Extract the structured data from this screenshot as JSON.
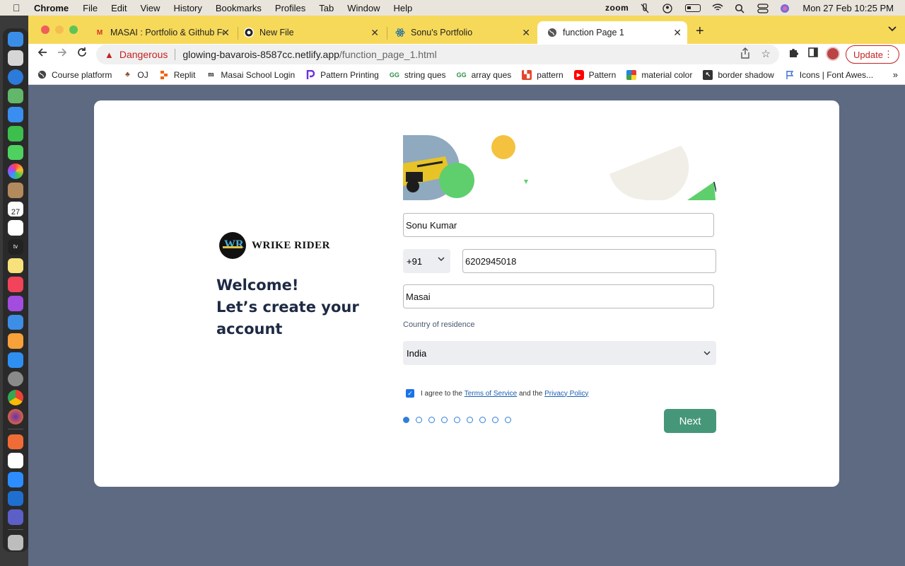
{
  "menubar": {
    "app_name": "Chrome",
    "menus": [
      "File",
      "Edit",
      "View",
      "History",
      "Bookmarks",
      "Profiles",
      "Tab",
      "Window",
      "Help"
    ],
    "zoom_label": "zoom",
    "datetime": "Mon 27 Feb  10:25 PM"
  },
  "dock": {
    "calendar_day": "27",
    "apps": [
      "finder",
      "launchpad",
      "safari",
      "maps",
      "mail",
      "facetime",
      "messages",
      "photos",
      "contacts",
      "calendar",
      "reminders",
      "apple-tv",
      "notes",
      "music",
      "podcasts",
      "keynote",
      "pages",
      "app-store",
      "system-preferences",
      "chrome",
      "firefox",
      "postman",
      "slack",
      "zoom",
      "vscode",
      "teams",
      "trash"
    ]
  },
  "tabs": [
    {
      "title": "MASAI : Portfolio & Github Fee",
      "icon": "gmail-icon",
      "active": false
    },
    {
      "title": "New File",
      "icon": "github-icon",
      "active": false
    },
    {
      "title": "Sonu's Portfolio",
      "icon": "react-icon",
      "active": false
    },
    {
      "title": "function Page 1",
      "icon": "globe-icon",
      "active": true
    }
  ],
  "toolbar": {
    "security_label": "Dangerous",
    "url_host": "glowing-bavarois-8587cc.netlify.app",
    "url_path": "/function_page_1.html",
    "update_label": "Update"
  },
  "bookmarks": [
    {
      "label": "Course platform",
      "icon": "globe-icon"
    },
    {
      "label": "OJ",
      "icon": "tree-icon"
    },
    {
      "label": "Replit",
      "icon": "replit-icon"
    },
    {
      "label": "Masai School Login",
      "icon": "masai-icon"
    },
    {
      "label": "Pattern Printing",
      "icon": "pattern-icon"
    },
    {
      "label": "string ques",
      "icon": "gfg-icon"
    },
    {
      "label": "array ques",
      "icon": "gfg-icon"
    },
    {
      "label": "pattern",
      "icon": "pattern-icon"
    },
    {
      "label": "Pattern",
      "icon": "youtube-icon"
    },
    {
      "label": "material color",
      "icon": "palette-icon"
    },
    {
      "label": "border shadow",
      "icon": "cursor-icon"
    },
    {
      "label": "Icons | Font Awes...",
      "icon": "flag-icon"
    }
  ],
  "form": {
    "brand_name": "WRIKE RIDER",
    "brand_logo_text": "WR",
    "welcome_line1": "Welcome!",
    "welcome_line2": "Let’s create your",
    "welcome_line3": "account",
    "name_value": "Sonu Kumar",
    "country_code": "+91",
    "phone_value": "6202945018",
    "org_value": "Masai",
    "country_label": "Country of residence",
    "country_value": "India",
    "agree_prefix": "I agree to the",
    "terms_link": "Terms of Service",
    "agree_middle": "and the",
    "privacy_link": "Privacy Policy",
    "agree_checked": true,
    "steps_total": 9,
    "current_step": 1,
    "next_label": "Next"
  },
  "colors": {
    "tabstrip": "#f7d95a",
    "page_bg": "#5d6a82",
    "next_button": "#46977a",
    "danger": "#c5221f",
    "step_blue": "#2f7fd8"
  }
}
